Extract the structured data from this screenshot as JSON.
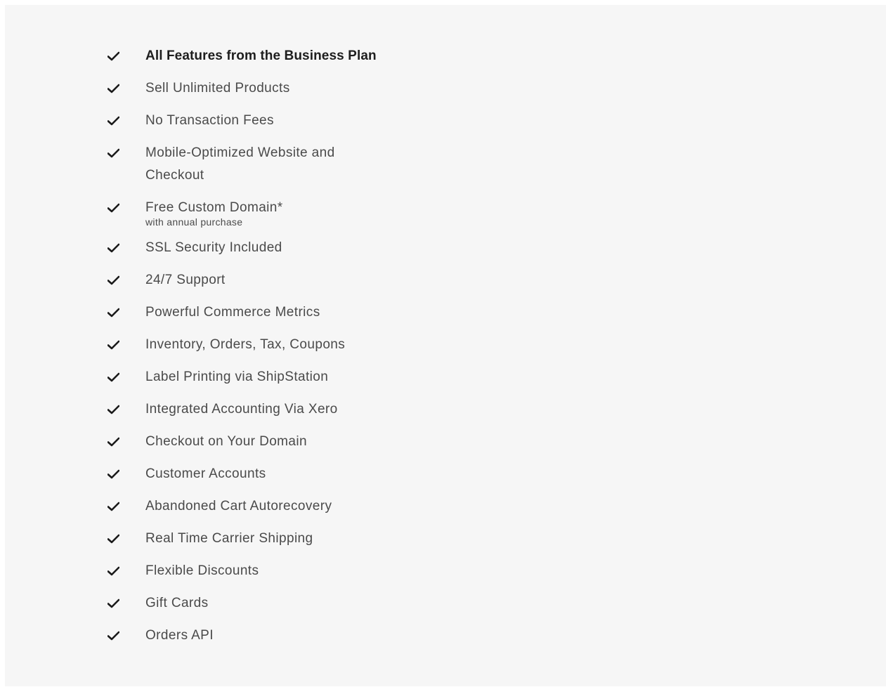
{
  "colors": {
    "panel_background": "#f6f6f6",
    "text": "#4a4a4a",
    "heading_text": "#1e1e1e",
    "check": "#1a1a1a"
  },
  "features": [
    {
      "label": "All Features from the Business Plan",
      "icon": "checkmark-icon"
    },
    {
      "label": "Sell Unlimited Products",
      "icon": "checkmark-icon"
    },
    {
      "label": "No Transaction Fees",
      "icon": "checkmark-icon"
    },
    {
      "label": "Mobile-Optimized Website and Checkout",
      "icon": "checkmark-icon"
    },
    {
      "label": "Free Custom Domain*",
      "note": "with annual purchase",
      "icon": "checkmark-icon"
    },
    {
      "label": "SSL Security Included",
      "icon": "checkmark-icon"
    },
    {
      "label": "24/7 Support",
      "icon": "checkmark-icon"
    },
    {
      "label": "Powerful Commerce Metrics",
      "icon": "checkmark-icon"
    },
    {
      "label": "Inventory, Orders, Tax, Coupons",
      "icon": "checkmark-icon"
    },
    {
      "label": "Label Printing via ShipStation",
      "icon": "checkmark-icon"
    },
    {
      "label": "Integrated Accounting Via Xero",
      "icon": "checkmark-icon"
    },
    {
      "label": "Checkout on Your Domain",
      "icon": "checkmark-icon"
    },
    {
      "label": "Customer Accounts",
      "icon": "checkmark-icon"
    },
    {
      "label": "Abandoned Cart Autorecovery",
      "icon": "checkmark-icon"
    },
    {
      "label": "Real Time Carrier Shipping",
      "icon": "checkmark-icon"
    },
    {
      "label": "Flexible Discounts",
      "icon": "checkmark-icon"
    },
    {
      "label": "Gift Cards",
      "icon": "checkmark-icon"
    },
    {
      "label": "Orders API",
      "icon": "checkmark-icon"
    }
  ]
}
